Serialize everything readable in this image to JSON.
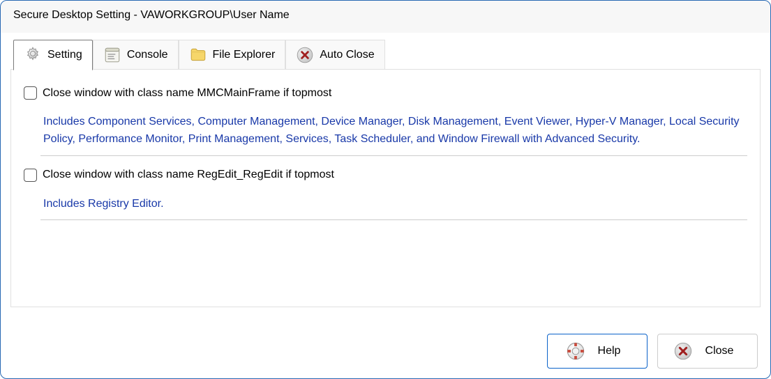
{
  "window": {
    "title": "Secure Desktop Setting - VAWORKGROUP\\User Name"
  },
  "tabs": {
    "setting": "Setting",
    "console": "Console",
    "file_explorer": "File Explorer",
    "auto_close": "Auto Close"
  },
  "settings": {
    "mmc": {
      "label": "Close window with class name MMCMainFrame if topmost",
      "description": "Includes Component Services, Computer Management, Device Manager, Disk Management, Event Viewer, Hyper-V Manager, Local Security Policy, Performance Monitor, Print Management, Services, Task Scheduler, and Window Firewall with Advanced Security."
    },
    "regedit": {
      "label": "Close window with class name RegEdit_RegEdit if topmost",
      "description": "Includes Registry Editor."
    }
  },
  "buttons": {
    "help": "Help",
    "close": "Close"
  }
}
